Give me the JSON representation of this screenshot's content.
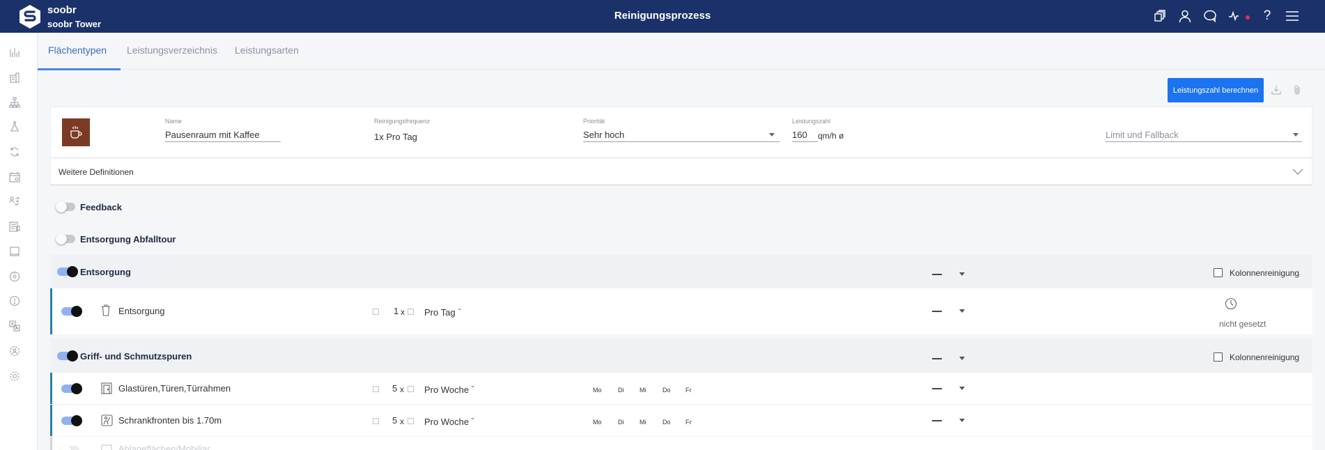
{
  "app": {
    "brand": "soobr",
    "brand_sub": "soobr Tower",
    "title": "Reinigungsprozess"
  },
  "header_icons": [
    "copy-icon",
    "user-icon",
    "chat-icon",
    "activity-icon",
    "help-icon",
    "menu-icon"
  ],
  "sidebar_icons": [
    "chart-icon",
    "building-icon",
    "hierarchy-icon",
    "flask-icon",
    "refresh-icon",
    "calendar-icon",
    "user-swap-icon",
    "report-icon",
    "book-icon",
    "gauge-icon",
    "info-icon",
    "translate-icon",
    "settings-group-icon",
    "gear-icon"
  ],
  "tabs": [
    {
      "label": "Flächentypen",
      "active": true
    },
    {
      "label": "Leistungsverzeichnis",
      "active": false
    },
    {
      "label": "Leistungsarten",
      "active": false
    }
  ],
  "actions": {
    "calculate_label": "Leistungszahl berechnen"
  },
  "area": {
    "name_label": "Name",
    "name_value": "Pausenraum mit Kaffee",
    "frequency_label": "Reinigungsfrequenz",
    "frequency_value": "1x Pro Tag",
    "priority_label": "Priorität",
    "priority_value": "Sehr hoch",
    "performance_label": "Leistungszahl",
    "performance_value": "160",
    "performance_unit": "qm/h ø",
    "limit_placeholder": "Limit und Fallback",
    "more_definitions": "Weitere Definitionen"
  },
  "groups": {
    "feedback": {
      "label": "Feedback",
      "enabled": false
    },
    "waste_tour": {
      "label": "Entsorgung Abfalltour",
      "enabled": false
    },
    "disposal": {
      "label": "Entsorgung",
      "enabled": true,
      "column_cleaning": "Kolonnenreinigung",
      "items": [
        {
          "label": "Entsorgung",
          "qty": "1",
          "x": "x",
          "freq": "Pro Tag",
          "time_status": "nicht gesetzt",
          "enabled": true
        }
      ]
    },
    "fingerprints": {
      "label": "Griff- und Schmutzspuren",
      "enabled": true,
      "column_cleaning": "Kolonnenreinigung",
      "items": [
        {
          "label": "Glastüren,Türen,Türrahmen",
          "qty": "5",
          "x": "x",
          "freq": "Pro Woche",
          "days": [
            "Mo",
            "Di",
            "Mi",
            "Do",
            "Fr"
          ],
          "enabled": true
        },
        {
          "label": "Schrankfronten bis 1.70m",
          "qty": "5",
          "x": "x",
          "freq": "Pro Woche",
          "days": [
            "Mo",
            "Di",
            "Mi",
            "Do",
            "Fr"
          ],
          "enabled": true
        },
        {
          "label": "Ablageflächen/Mobiliar",
          "enabled": false
        }
      ]
    }
  }
}
